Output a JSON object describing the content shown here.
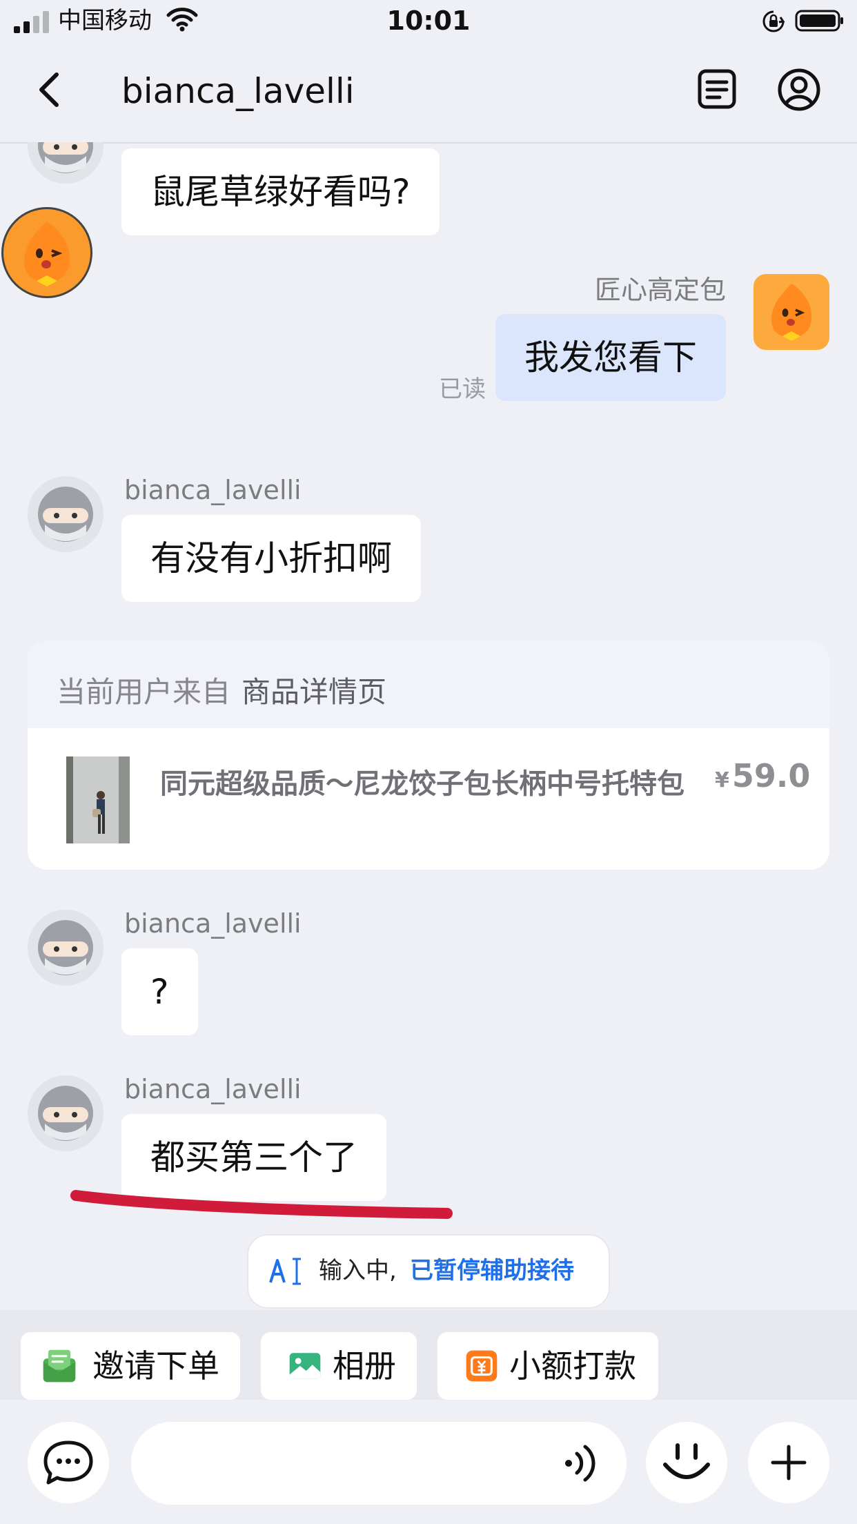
{
  "status_bar": {
    "carrier": "中国移动",
    "time": "10:01"
  },
  "header": {
    "title": "bianca_lavelli"
  },
  "messages": {
    "m1_text": "鼠尾草绿好看吗?",
    "m2_sender": "匠心高定包",
    "m2_text": "我发您看下",
    "m2_read": "已读",
    "m3_sender": "bianca_lavelli",
    "m3_text": "有没有小折扣啊",
    "m4_sender": "bianca_lavelli",
    "m4_text": "?",
    "m5_sender": "bianca_lavelli",
    "m5_text": "都买第三个了"
  },
  "product_card": {
    "source_prefix": "当前用户来自",
    "source": "商品详情页",
    "name": "同元超级品质～尼龙饺子包长柄中号托特包",
    "currency": "¥",
    "price": "59.0"
  },
  "typing_status": {
    "text": "输入中,",
    "link": "已暂停辅助接待"
  },
  "quick_actions": [
    {
      "label": "邀请下单",
      "icon": "invite-order-icon",
      "color": "#4caf50"
    },
    {
      "label": "相册",
      "icon": "album-icon",
      "color": "#37b37e"
    },
    {
      "label": "小额打款",
      "icon": "small-payment-icon",
      "color": "#ff7a1a"
    }
  ],
  "input": {
    "placeholder": ""
  },
  "colors": {
    "accent": "#1f6fe6",
    "self_bubble": "#dbe6fd",
    "highlight_stroke": "#d01c3a"
  }
}
